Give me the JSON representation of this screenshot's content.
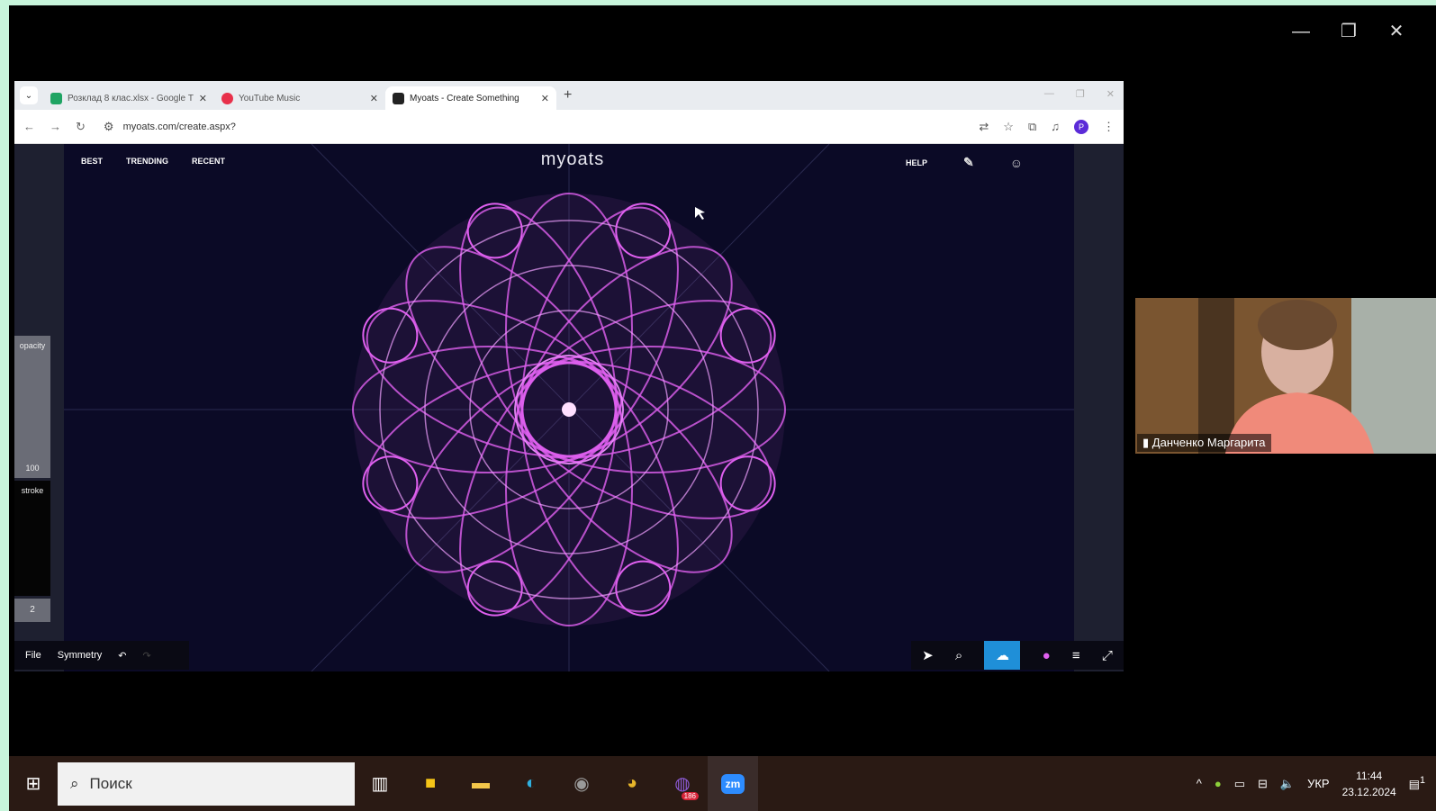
{
  "window_controls": {
    "minimize": "—",
    "restore": "❐",
    "close": "✕"
  },
  "browser": {
    "tabs": [
      {
        "title": "Розклад 8 клас.xlsx - Google Т",
        "favicon_color": "#1fa463",
        "active": false
      },
      {
        "title": "YouTube Music",
        "favicon_color": "#e8304a",
        "active": false
      },
      {
        "title": "Myoats - Create Something",
        "favicon_color": "#222222",
        "active": true
      }
    ],
    "new_tab": "+",
    "url": "myoats.com/create.aspx?",
    "profile_initial": "P"
  },
  "myoats": {
    "nav": [
      "BEST",
      "TRENDING",
      "RECENT"
    ],
    "logo": "myoats",
    "help": "HELP",
    "opacity_label": "opacity",
    "opacity_value": "100",
    "stroke_label": "stroke",
    "stroke_value": "2",
    "bottom_left": {
      "file": "File",
      "symmetry": "Symmetry"
    },
    "accent_color": "#e060f0"
  },
  "participant": {
    "name": "Данченко Маргарита"
  },
  "taskbar": {
    "search_placeholder": "Поиск",
    "zoom_label": "zm",
    "viber_badge": "186",
    "lang": "УКР",
    "time": "11:44",
    "date": "23.12.2024",
    "notification_count": "1"
  }
}
